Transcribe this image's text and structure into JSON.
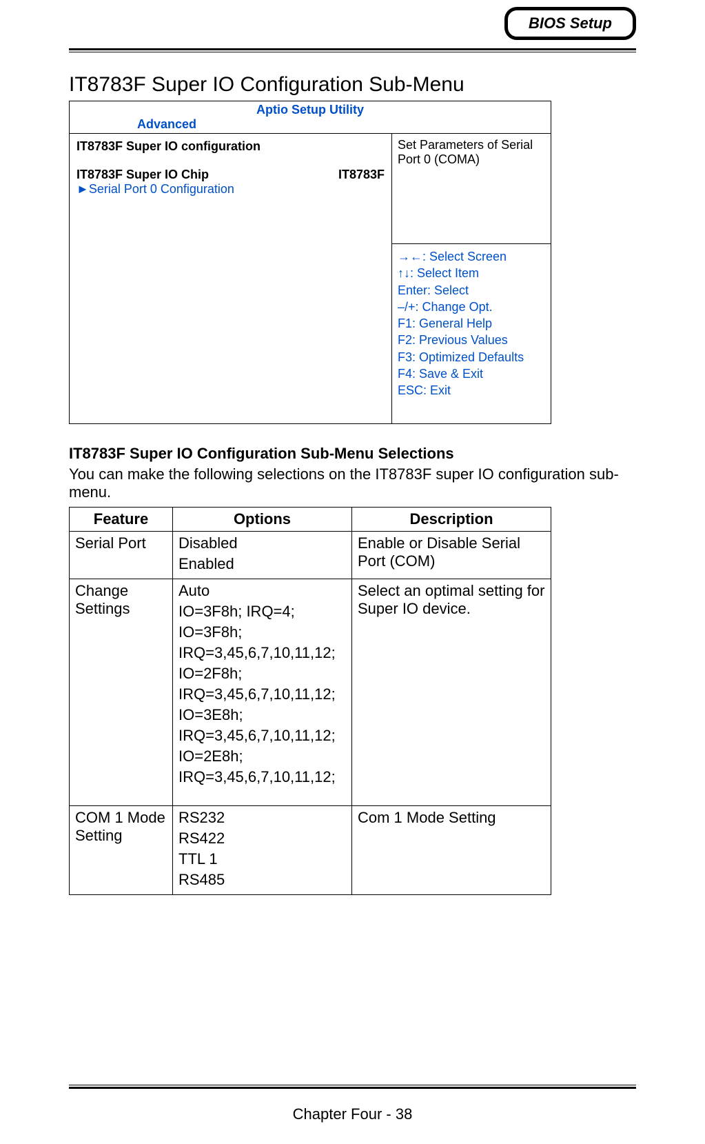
{
  "header": {
    "badge": "BIOS Setup"
  },
  "sectionTitle": "IT8783F Super IO Configuration Sub-Menu",
  "bios": {
    "utility": "Aptio Setup Utility",
    "tab": "Advanced",
    "configTitle": "IT8783F Super IO configuration",
    "chipLabel": "IT8783F Super IO Chip",
    "chipValue": "IT8783F",
    "linkPrefix": "►",
    "link": "Serial Port 0 Configuration",
    "help": "Set Parameters of Serial Port 0 (COMA)",
    "keys": {
      "k1": "→←: Select Screen",
      "k2": "↑↓: Select Item",
      "k3": "Enter: Select",
      "k4": "–/+: Change Opt.",
      "k5": "F1: General Help",
      "k6": "F2: Previous Values",
      "k7": "F3: Optimized Defaults",
      "k8": "F4: Save & Exit",
      "k9": "ESC: Exit"
    }
  },
  "subheading": "IT8783F Super IO Configuration Sub-Menu Selections",
  "intro": "You can make the following selections on the IT8783F super IO configuration sub-menu.",
  "tableHeaders": {
    "feature": "Feature",
    "options": "Options",
    "description": "Description"
  },
  "rows": {
    "r0": {
      "feature": "Serial Port",
      "opt1": "Disabled",
      "opt2": "Enabled",
      "desc": "Enable or Disable Serial Port (COM)"
    },
    "r1": {
      "feature": "Change Settings",
      "opt1": "Auto",
      "opt2": "IO=3F8h; IRQ=4;",
      "opt3": "IO=3F8h;",
      "opt4": "IRQ=3,45,6,7,10,11,12;",
      "opt5": "IO=2F8h;",
      "opt6": "IRQ=3,45,6,7,10,11,12;",
      "opt7": "IO=3E8h;",
      "opt8": "IRQ=3,45,6,7,10,11,12;",
      "opt9": "IO=2E8h;",
      "opt10": "IRQ=3,45,6,7,10,11,12;",
      "desc": "Select an optimal setting for Super IO device."
    },
    "r2": {
      "feature": "COM 1 Mode Setting",
      "opt1": "RS232",
      "opt2": "RS422",
      "opt3": "TTL 1",
      "opt4": "RS485",
      "desc": "Com 1 Mode Setting"
    }
  },
  "footer": "Chapter Four - 38"
}
